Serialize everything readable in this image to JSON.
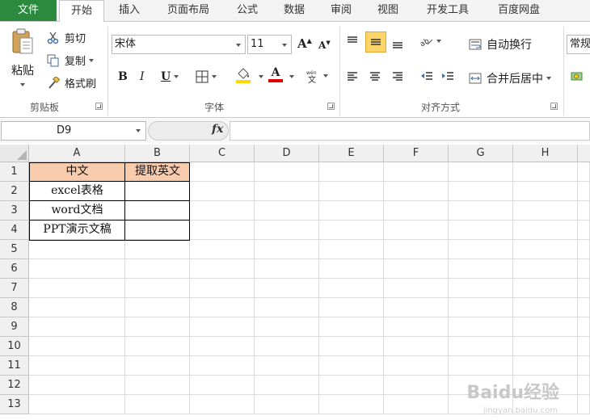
{
  "ribbon_tabs": [
    "文件",
    "开始",
    "插入",
    "页面布局",
    "公式",
    "数据",
    "审阅",
    "视图",
    "开发工具",
    "百度网盘"
  ],
  "clipboard": {
    "paste": "粘贴",
    "cut": "剪切",
    "copy": "复制",
    "format_painter": "格式刷",
    "group_label": "剪贴板"
  },
  "font": {
    "name": "宋体",
    "size": "11",
    "bold": "B",
    "italic": "I",
    "underline": "U",
    "font_color_letter": "A",
    "group_label": "字体"
  },
  "alignment": {
    "wrap_text": "自动换行",
    "merge_center": "合并后居中",
    "group_label": "对齐方式"
  },
  "number": {
    "format": "常规"
  },
  "formula_bar": {
    "name_box": "D9",
    "fx": "fx",
    "content": ""
  },
  "sheet": {
    "columns": [
      "A",
      "B",
      "C",
      "D",
      "E",
      "F",
      "G",
      "H"
    ],
    "rows": [
      "1",
      "2",
      "3",
      "4",
      "5",
      "6",
      "7",
      "8",
      "9",
      "10",
      "11",
      "12",
      "13"
    ],
    "cells": {
      "A1": "中文",
      "B1": "提取英文",
      "A2": "excel表格",
      "A3": "word文档",
      "A4": "PPT演示文稿"
    },
    "header_fill": "#f8cbad"
  },
  "watermark": {
    "text": "Baidu经验",
    "url": "jingyan.baidu.com"
  },
  "colors": {
    "file_tab": "#2c8a3e",
    "font_color_bar": "#e00000",
    "fill_color_bar": "#ffd800",
    "selected_button": "#fcd56a"
  }
}
